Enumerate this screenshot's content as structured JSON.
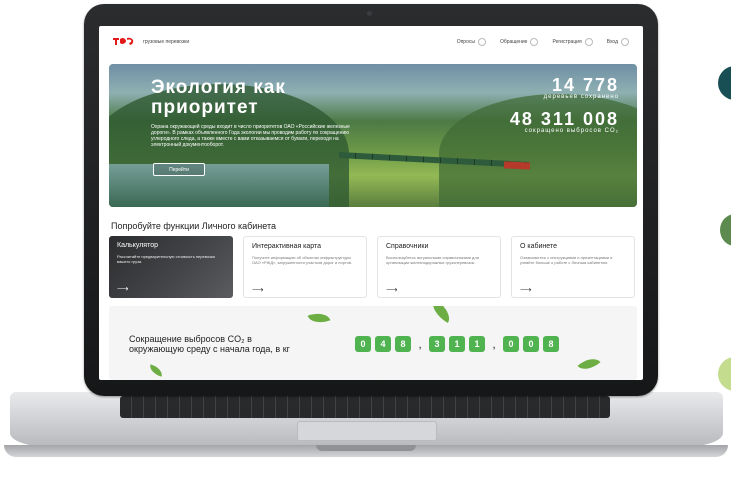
{
  "nav": {
    "brand_text": "грузовые перевозки",
    "items": [
      "Опросы",
      "Обращение",
      "Регистрация",
      "Вход"
    ]
  },
  "hero": {
    "title": "Экология как приоритет",
    "text": "Охрана окружающей среды входит в число приоритетов ОАО «Российские железные дороги». В рамках объявленного Года экологии мы проводим работу по сокращению углеродного следа, а также вместе с вами отказываемся от бумаги, переходя на электронный документооборот.",
    "button": "Перейти",
    "stat1_value": "14 778",
    "stat1_caption": "деревьев сохранено",
    "stat2_value": "48 311 008",
    "stat2_caption": "сокращено выбросов CO₂"
  },
  "section_title": "Попробуйте функции Личного кабинета",
  "cards": [
    {
      "title": "Калькулятор",
      "desc": "Рассчитайте предварительную стоимость перевозки вашего груза.",
      "arrow": "⟶"
    },
    {
      "title": "Интерактивная карта",
      "desc": "Получите информацию об объектах инфраструктуры ОАО «РЖД», загруженности участков дорог и портов.",
      "arrow": "⟶"
    },
    {
      "title": "Справочники",
      "desc": "Воспользуйтесь актуальными справочниками для организации железнодорожных грузоперевозок.",
      "arrow": "⟶"
    },
    {
      "title": "О кабинете",
      "desc": "Ознакомьтесь с инструкциями и презентациями и узнайте больше о работе с Личным кабинетом.",
      "arrow": "⟶"
    }
  ],
  "counter": {
    "text": "Сокращение выбросов CO₂ в окружающую среду с начала года, в кг",
    "digits": [
      "0",
      "4",
      "8",
      ",",
      "3",
      "1",
      "1",
      ",",
      "0",
      "0",
      "8"
    ]
  },
  "colors": {
    "brand_red": "#e21a1a",
    "digit_green": "#4fb34f",
    "dot_dark_teal": "#184f55",
    "dot_green": "#5d8a4f",
    "dot_light_green": "#c3dc8e"
  }
}
